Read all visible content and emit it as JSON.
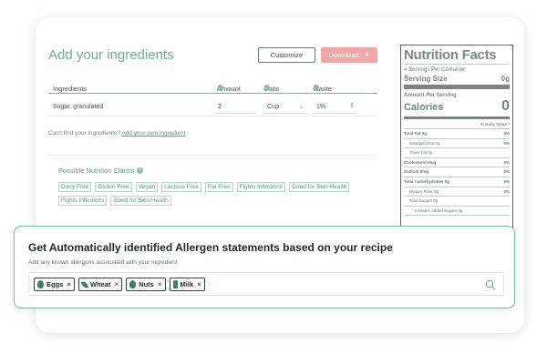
{
  "ingredients": {
    "title": "Add your ingredients",
    "customize_label": "Customize",
    "download_label": "Download",
    "columns": [
      "Ingredients",
      "Amount",
      "Units",
      "Waste"
    ],
    "rows": [
      {
        "name": "Sugar, granulated",
        "amount": "2",
        "unit": "Cup",
        "waste": "1%"
      }
    ],
    "find_text": "Can't find your ingredients?",
    "find_link": "Add your own ingredient"
  },
  "claims": {
    "title": "Possible Nutrition Claims",
    "tags": [
      "Dairy Free",
      "Gluten Free",
      "Vegan",
      "Lactose Free",
      "Fat Free",
      "Fights Infections",
      "Good for Skin Health",
      "Fights Infections",
      "Good for Skin Health"
    ]
  },
  "nutrition": {
    "title": "Nutrition Facts",
    "servings": "4 Servings Per Container",
    "serving_size_label": "Serving Size",
    "serving_size_value": "0g",
    "amount_per_serving": "Amount Per Serving",
    "calories_label": "Calories",
    "calories_value": "0",
    "daily_value_label": "% Daily Value *",
    "rows": [
      {
        "label": "Total Fat 0g",
        "pct": "0%"
      },
      {
        "label": "Saturated Fat 0g",
        "pct": "0%"
      },
      {
        "label": "Trans Fat 0g",
        "pct": ""
      },
      {
        "label": "Cholesterol 0mg",
        "pct": "0%"
      },
      {
        "label": "Sodium 0mg",
        "pct": "0%"
      },
      {
        "label": "Total Carbohydrates 0g",
        "pct": "0%"
      },
      {
        "label": "Dietary Fiber 0g",
        "pct": "0%"
      },
      {
        "label": "Total Sugars 0g",
        "pct": ""
      },
      {
        "label": "Includes Added Sugars 0g",
        "pct": ""
      }
    ]
  },
  "allergen": {
    "title": "Get Automatically identified Allergen statements  based on your recipe",
    "subtitle": "Add any known allergens associated with your ingredient",
    "chips": [
      {
        "label": "Eggs",
        "icon": "egg-icon"
      },
      {
        "label": "Wheat",
        "icon": "wheat-icon"
      },
      {
        "label": "Nuts",
        "icon": "nut-icon"
      },
      {
        "label": "Milk",
        "icon": "milk-icon"
      }
    ]
  },
  "colors": {
    "accent": "#78aa9c",
    "download": "#f0a7a7",
    "chip_border": "#2d4a41"
  }
}
